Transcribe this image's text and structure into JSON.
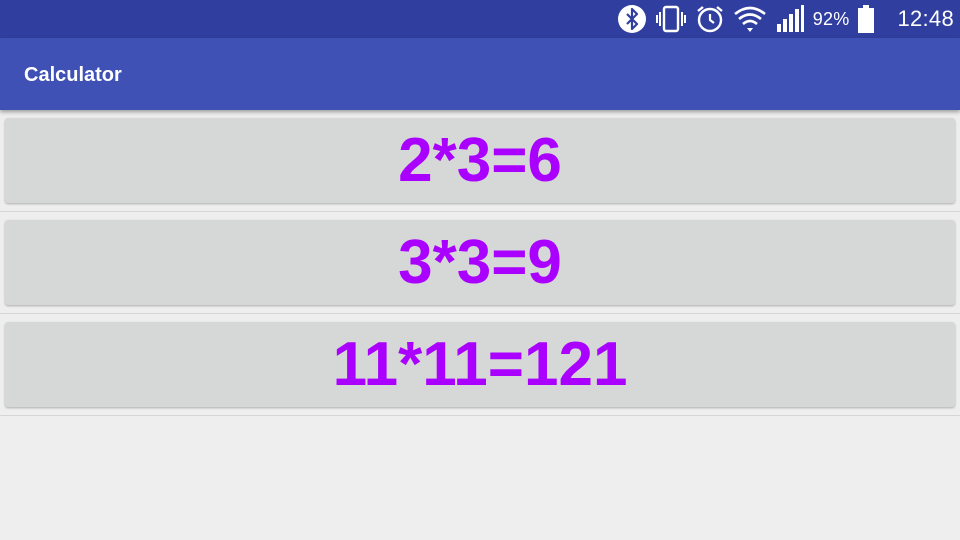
{
  "status_bar": {
    "icons": [
      "bluetooth-icon",
      "vibrate-icon",
      "alarm-icon",
      "wifi-icon",
      "signal-icon"
    ],
    "battery_percent": "92%",
    "battery_icon": "battery-icon",
    "time": "12:48",
    "background_color": "#303f9f"
  },
  "app_bar": {
    "title": "Calculator",
    "background_color": "#3f51b5"
  },
  "calculations": [
    {
      "label": "2*3=6"
    },
    {
      "label": "3*3=9"
    },
    {
      "label": "11*11=121"
    }
  ],
  "colors": {
    "result_text": "#aa00ff",
    "button_background": "#d6d7d7",
    "page_background": "#eeeeee"
  }
}
